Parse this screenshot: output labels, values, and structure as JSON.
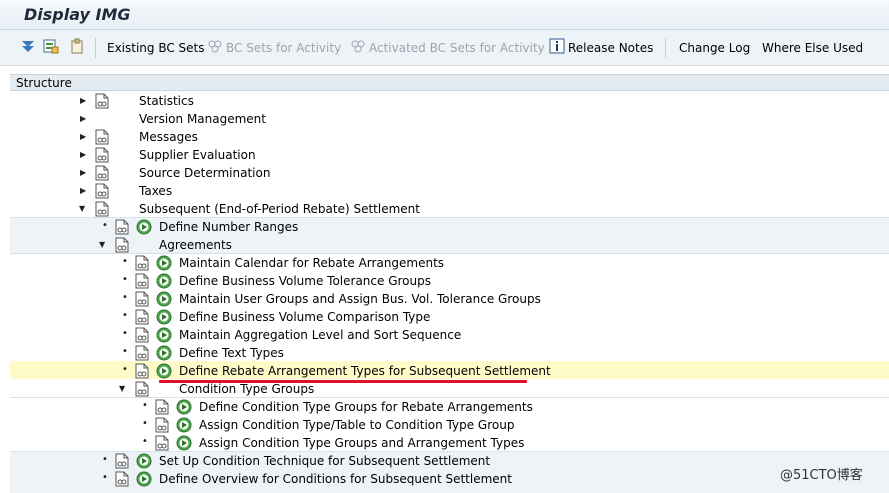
{
  "window": {
    "title": "Display IMG"
  },
  "toolbar": {
    "existing_bc_sets": "Existing BC Sets",
    "bc_sets_for_activity": "BC Sets for Activity",
    "activated_bc_sets_for_activity": "Activated BC Sets for Activity",
    "release_notes": "Release Notes",
    "change_log": "Change Log",
    "where_else_used": "Where Else Used"
  },
  "structure": {
    "header": "Structure"
  },
  "tree": {
    "statistics": "Statistics",
    "version_management": "Version Management",
    "messages": "Messages",
    "supplier_evaluation": "Supplier Evaluation",
    "source_determination": "Source Determination",
    "taxes": "Taxes",
    "subsequent_settlement": "Subsequent (End-of-Period Rebate) Settlement",
    "define_number_ranges": "Define Number Ranges",
    "agreements": "Agreements",
    "maintain_calendar": "Maintain Calendar for Rebate Arrangements",
    "define_bv_tolerance_groups": "Define Business Volume Tolerance Groups",
    "maintain_user_groups": "Maintain User Groups and Assign Bus. Vol. Tolerance Groups",
    "define_bv_comparison_type": "Define Business Volume Comparison Type",
    "maintain_aggregation_level": "Maintain Aggregation Level and Sort Sequence",
    "define_text_types": "Define Text Types",
    "define_rebate_arrangement_types": "Define Rebate Arrangement Types for Subsequent Settlement",
    "condition_type_groups": "Condition Type Groups",
    "define_condition_type_groups": "Define Condition Type Groups for Rebate Arrangements",
    "assign_condition_type_table": "Assign Condition Type/Table to Condition Type Group",
    "assign_condition_type_groups": "Assign Condition Type Groups and Arrangement Types",
    "set_up_condition_technique": "Set Up Condition Technique for Subsequent Settlement",
    "define_overview_conditions": "Define Overview for Conditions for Subsequent Settlement"
  },
  "watermark": "@51CTO博客",
  "colors": {
    "selected_row": "#fffbc8",
    "red_underline": "#e0102a",
    "group_band": "#eef3f7"
  }
}
